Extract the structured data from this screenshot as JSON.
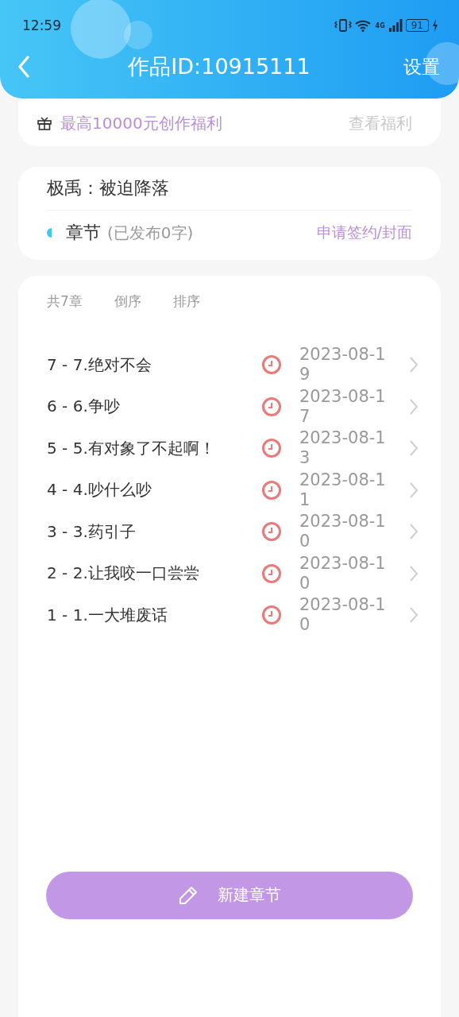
{
  "status_bar": {
    "time": "12:59",
    "network": "4G",
    "battery": "91"
  },
  "header": {
    "title": "作品ID:10915111",
    "action": "设置"
  },
  "promo": {
    "text": "最高10000元创作福利",
    "link": "查看福利"
  },
  "work": {
    "title": "极禹：被迫降落",
    "section_label": "章节",
    "section_note": "(已发布0字)",
    "link": "申请签约/封面"
  },
  "chapters": {
    "count": "共7章",
    "sort_reverse": "倒序",
    "sort": "排序",
    "items": [
      {
        "title": "7 - 7.绝对不会",
        "date": "2023-08-19"
      },
      {
        "title": "6 - 6.争吵",
        "date": "2023-08-17"
      },
      {
        "title": "5 - 5.有对象了不起啊！",
        "date": "2023-08-13"
      },
      {
        "title": "4 - 4.吵什么吵",
        "date": "2023-08-11"
      },
      {
        "title": "3 - 3.药引子",
        "date": "2023-08-10"
      },
      {
        "title": "2 - 2.让我咬一口尝尝",
        "date": "2023-08-10"
      },
      {
        "title": "1 - 1.一大堆废话",
        "date": "2023-08-10"
      }
    ]
  },
  "new_chapter_button": "新建章节"
}
